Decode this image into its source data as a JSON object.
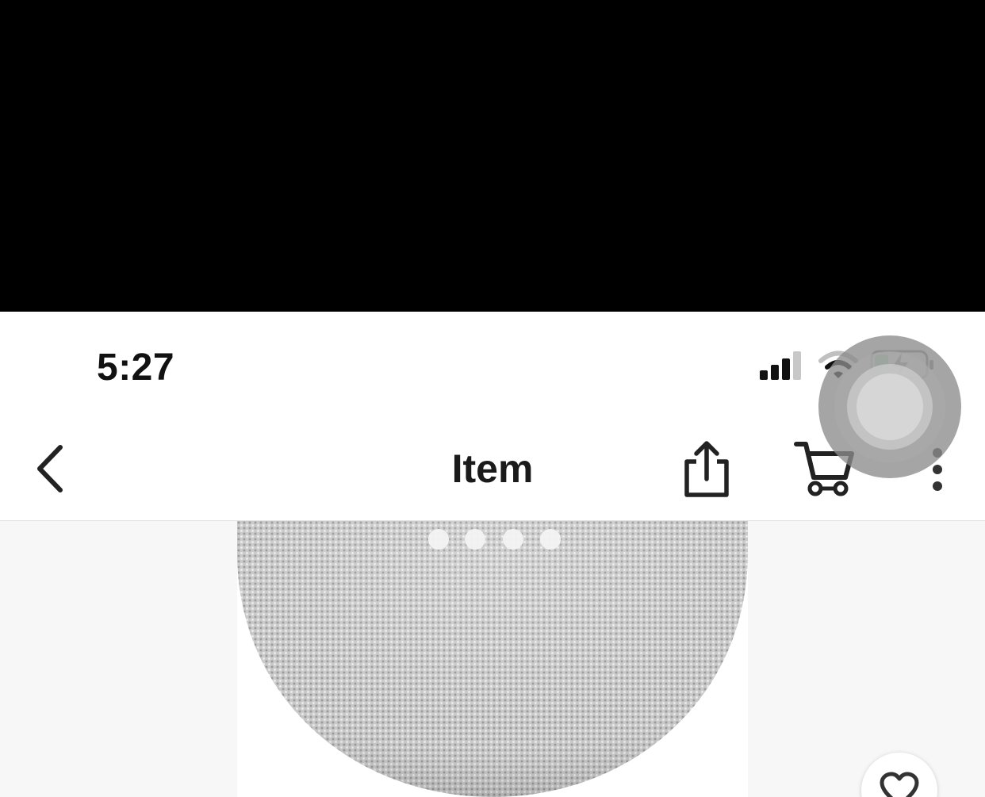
{
  "status_bar": {
    "time": "5:27",
    "signal_icon": "cellular-signal-icon",
    "wifi_icon": "wifi-icon",
    "battery_icon": "battery-charging-icon",
    "battery_level": 0.25,
    "battery_color": "#4cd964"
  },
  "nav": {
    "title": "Item",
    "back_icon": "chevron-left-icon",
    "share_icon": "share-icon",
    "cart_icon": "cart-icon",
    "more_icon": "more-vertical-icon"
  },
  "product": {
    "image": "smart-speaker-image",
    "favorite_icon": "heart-icon"
  },
  "overlay": {
    "assistive_touch_icon": "assistive-touch-icon"
  },
  "colors": {
    "text_primary": "#1a1a1a",
    "nav_background": "#ffffff",
    "gallery_background": "#f7f7f7"
  }
}
